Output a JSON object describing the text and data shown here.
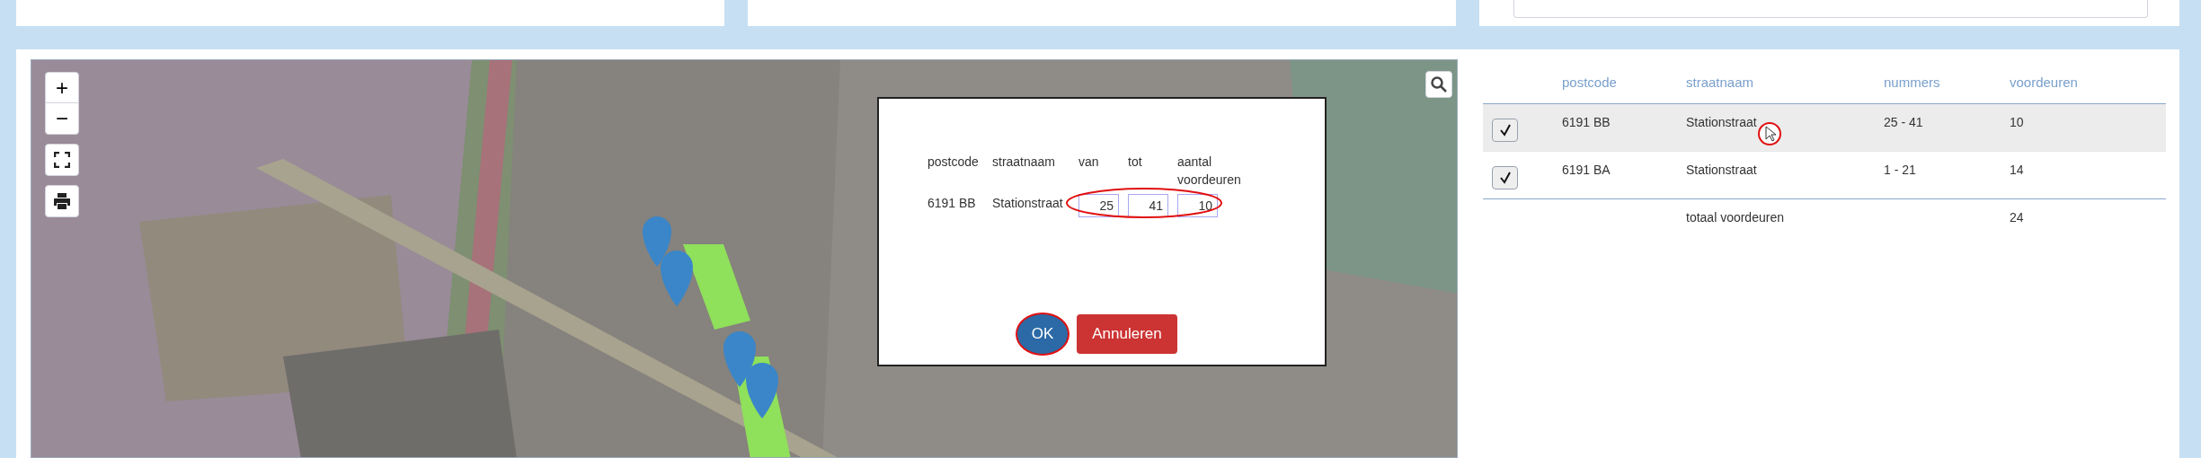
{
  "map": {
    "zoom_buttons": [
      {
        "label": "+"
      },
      {
        "label": "−"
      }
    ]
  },
  "dialog": {
    "columns": [
      "postcode",
      "straatnaam",
      "van",
      "tot",
      "aantal voordeuren"
    ],
    "row": {
      "postcode": "6191 BB",
      "straatnaam": "Stationstraat",
      "van": "25",
      "tot": "41",
      "aantal": "10"
    },
    "buttons": [
      {
        "label": "OK",
        "kind": "primary"
      },
      {
        "label": "Annuleren",
        "kind": "danger"
      }
    ]
  },
  "table": {
    "columns": [
      "postcode",
      "straatnaam",
      "nummers",
      "voordeuren"
    ],
    "rows": [
      {
        "checked": true,
        "selected": true,
        "postcode": "6191 BB",
        "straatnaam": "Stationstraat",
        "nummers": "25 - 41",
        "voordeuren": "10"
      },
      {
        "checked": true,
        "selected": false,
        "postcode": "6191 BA",
        "straatnaam": "Stationstraat",
        "nummers": "1 - 21",
        "voordeuren": "14"
      }
    ],
    "total": {
      "label": "totaal voordeuren",
      "value": "24"
    }
  }
}
